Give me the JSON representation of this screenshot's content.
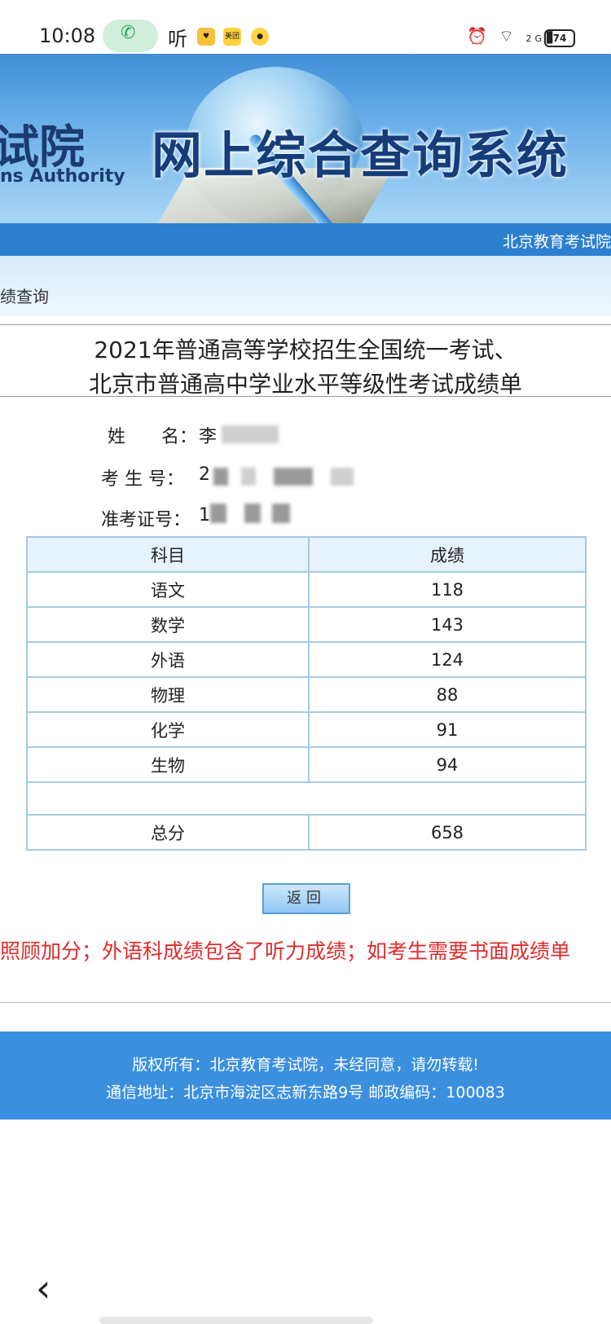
{
  "status_bar": {
    "time": "10:08",
    "listen_label": "听",
    "app_meituan": "美团",
    "battery": "74",
    "net_label": "2G"
  },
  "header": {
    "logo_partial": "试院",
    "english_partial": "ns Authority",
    "title": "网上综合查询系统"
  },
  "nav": {
    "right_text": "北京教育考试院"
  },
  "breadcrumb": "绩查询",
  "report": {
    "title_line1": "2021年普通高等学校招生全国统一考试、",
    "title_line2": "北京市普通高中学业水平等级性考试成绩单",
    "name_label": "姓　　名：",
    "name_value": "李",
    "examinee_label": "考 生 号：",
    "examinee_value": "2",
    "admission_label": "准考证号：",
    "admission_value": "1"
  },
  "table": {
    "headers": [
      "科目",
      "成绩"
    ],
    "rows": [
      {
        "subject": "语文",
        "score": "118"
      },
      {
        "subject": "数学",
        "score": "143"
      },
      {
        "subject": "外语",
        "score": "124"
      },
      {
        "subject": "物理",
        "score": "88"
      },
      {
        "subject": "化学",
        "score": "91"
      },
      {
        "subject": "生物",
        "score": "94"
      }
    ],
    "total_label": "总分",
    "total_value": "658"
  },
  "return_button": "返回",
  "notice": "照顾加分；外语科成绩包含了听力成绩；如考生需要书面成绩单",
  "footer": {
    "line1": "版权所有：北京教育考试院，未经同意，请勿转载!",
    "line2": "通信地址：北京市海淀区志新东路9号 邮政编码：100083"
  },
  "colors": {
    "nav_blue": "#2d7fcf",
    "footer_blue": "#3a8fdf",
    "notice_red": "#e02b2b",
    "table_border": "#a6cbe3"
  }
}
